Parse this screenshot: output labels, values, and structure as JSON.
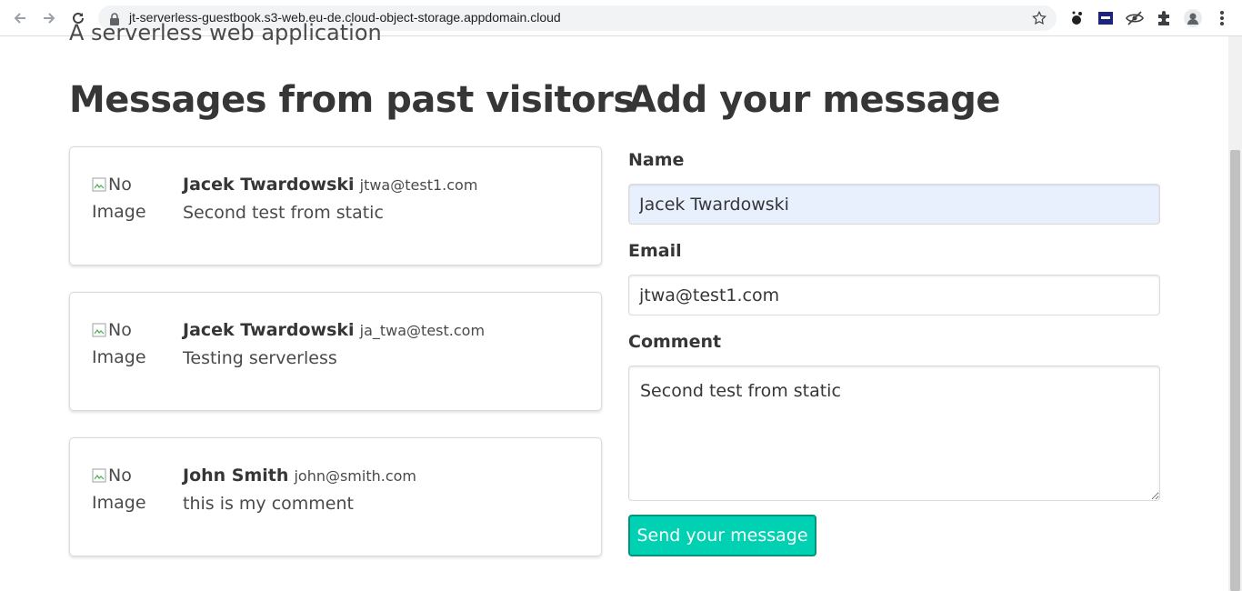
{
  "browser": {
    "url": "jt-serverless-guestbook.s3-web.eu-de.cloud-object-storage.appdomain.cloud"
  },
  "page": {
    "subtitle": "A serverless web application",
    "messages_title": "Messages from past visitors",
    "form_title": "Add your message"
  },
  "messages": [
    {
      "alt_line1": "No",
      "alt_line2": "Image",
      "name": "Jacek Twardowski",
      "email": "jtwa@test1.com",
      "comment": "Second test from static"
    },
    {
      "alt_line1": "No",
      "alt_line2": "Image",
      "name": "Jacek Twardowski",
      "email": "ja_twa@test.com",
      "comment": "Testing serverless"
    },
    {
      "alt_line1": "No",
      "alt_line2": "Image",
      "name": "John Smith",
      "email": "john@smith.com",
      "comment": "this is my comment"
    }
  ],
  "form": {
    "name_label": "Name",
    "name_value": "Jacek Twardowski",
    "email_label": "Email",
    "email_value": "jtwa@test1.com",
    "comment_label": "Comment",
    "comment_value": "Second test from static",
    "submit_label": "Send your message"
  },
  "colors": {
    "primary": "#00d1b2",
    "autofill": "#e8f0fe"
  }
}
